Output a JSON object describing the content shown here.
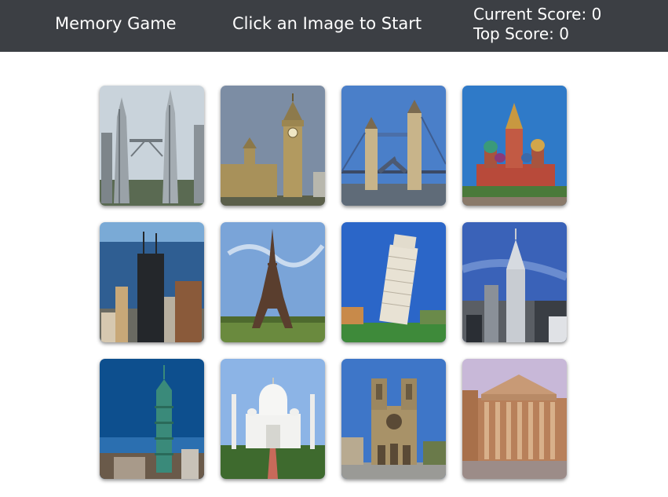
{
  "navbar": {
    "title": "Memory Game",
    "message": "Click an Image to Start",
    "current_score": "Current Score: 0",
    "top_score": "Top Score: 0"
  },
  "cards": [
    {
      "landmark": "petronas-towers"
    },
    {
      "landmark": "big-ben"
    },
    {
      "landmark": "tower-bridge"
    },
    {
      "landmark": "st-basils-cathedral"
    },
    {
      "landmark": "willis-tower"
    },
    {
      "landmark": "eiffel-tower"
    },
    {
      "landmark": "leaning-tower-of-pisa"
    },
    {
      "landmark": "chrysler-building"
    },
    {
      "landmark": "taipei-101"
    },
    {
      "landmark": "taj-mahal"
    },
    {
      "landmark": "notre-dame"
    },
    {
      "landmark": "pantheon"
    }
  ]
}
